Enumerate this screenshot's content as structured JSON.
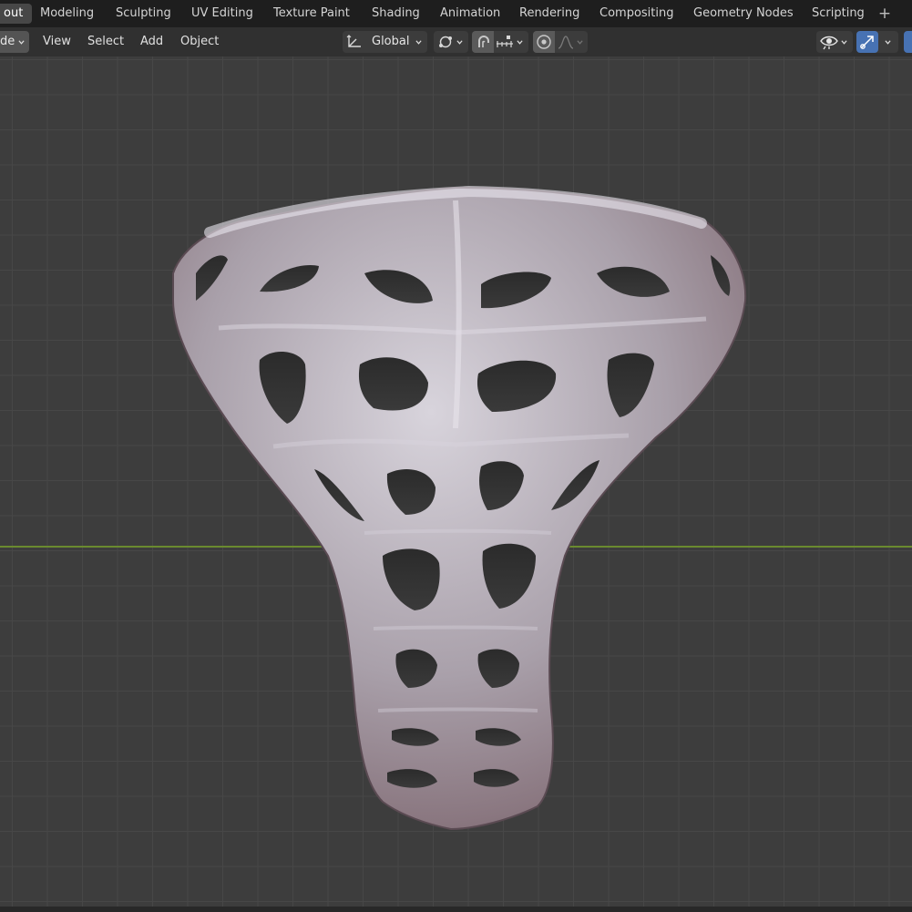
{
  "workspace_tabs": {
    "active": "out",
    "items": [
      "Modeling",
      "Sculpting",
      "UV Editing",
      "Texture Paint",
      "Shading",
      "Animation",
      "Rendering",
      "Compositing",
      "Geometry Nodes",
      "Scripting"
    ],
    "add_icon": "plus-icon"
  },
  "header": {
    "mode_label": "de",
    "menus": [
      "View",
      "Select",
      "Add",
      "Object"
    ],
    "transform_orientation": "Global",
    "icons": {
      "orientation": "transform-axes-icon",
      "pivot": "pivot-point-icon",
      "snap": "magnet-icon",
      "snap_target": "snap-increment-icon",
      "proportional": "proportional-edit-icon",
      "falloff": "falloff-curve-icon",
      "visibility": "eye-icon",
      "gizmo": "gizmo-icon"
    }
  },
  "viewport": {
    "x_axis_color": "#6a8a2f",
    "grid_color": "#474747",
    "background": "#3d3d3d",
    "object": "voronoi-lattice-pendant-mesh"
  },
  "colors": {
    "topbar": "#1e1e1e",
    "header": "#303030",
    "active_tab": "#474747",
    "accent_blue": "#4772b3"
  }
}
